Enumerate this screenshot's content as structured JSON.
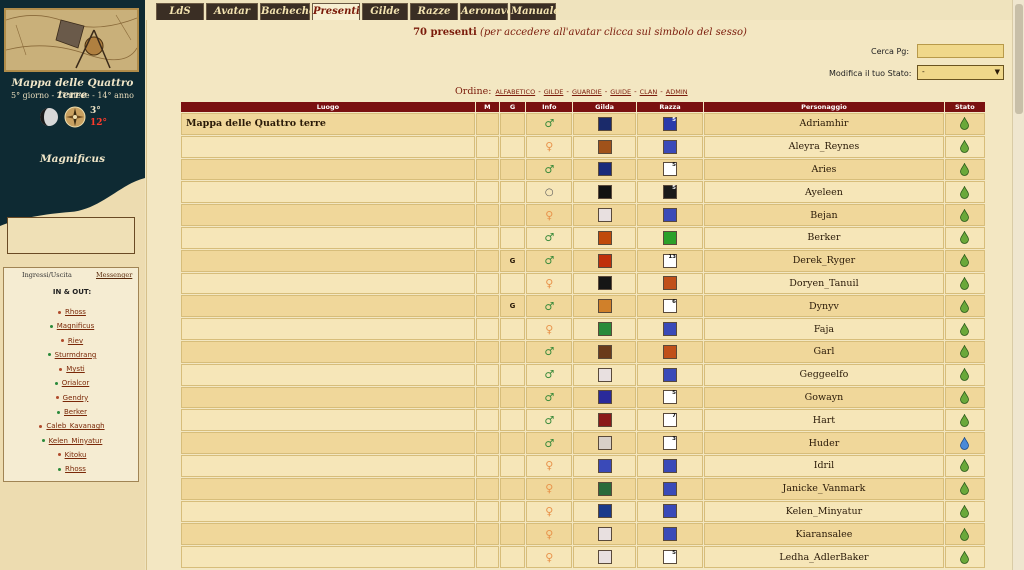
{
  "sidebar": {
    "world_title": "Mappa delle Quattro terre",
    "date": "5° giorno - 2° mese - 14° anno",
    "temp_low": "3°",
    "temp_high": "12°",
    "user_name": "Magnificus",
    "inout": {
      "tab_ingressi": "Ingressi/Uscita",
      "tab_messenger": "Messenger",
      "heading": "IN & OUT:",
      "items": [
        {
          "name": "Rhoss",
          "dot": "#b04a2a"
        },
        {
          "name": "Magnificus",
          "dot": "#2a8a3a"
        },
        {
          "name": "Riev",
          "dot": "#b04a2a"
        },
        {
          "name": "Sturmdrang",
          "dot": "#2a8a3a"
        },
        {
          "name": "Mysti",
          "dot": "#b04a2a"
        },
        {
          "name": "Orialcor",
          "dot": "#2a8a3a"
        },
        {
          "name": "Gendry",
          "dot": "#b04a2a"
        },
        {
          "name": "Berker",
          "dot": "#2a8a3a"
        },
        {
          "name": "Caleb_Kavanagh",
          "dot": "#b04a2a"
        },
        {
          "name": "Kelen_Minyatur",
          "dot": "#2a8a3a"
        },
        {
          "name": "Kitoku",
          "dot": "#b04a2a"
        },
        {
          "name": "Rhoss",
          "dot": "#2a8a3a"
        }
      ]
    }
  },
  "tabs": [
    "LdS",
    "Avatar",
    "Bacheche",
    "Presenti",
    "Gilde",
    "Razze",
    "Aeronave",
    "Manuale"
  ],
  "active_tab": "Presenti",
  "header": {
    "count": "70 presenti",
    "hint": "(per accedere all'avatar clicca sul simbolo del sesso)",
    "cerca_label": "Cerca Pg:",
    "cerca_value": "",
    "stato_label": "Modifica il tuo Stato:",
    "stato_value": "-",
    "ordine_label": "Ordine:",
    "ordine_links": [
      "ALFABETICO",
      "GILDE",
      "GUARDIE",
      "GUIDE",
      "CLAN",
      "ADMIN"
    ]
  },
  "table": {
    "columns": [
      "Luogo",
      "M",
      "G",
      "Info",
      "Gilda",
      "Razza",
      "Personaggio",
      "Stato"
    ],
    "location": "Mappa delle Quattro terre",
    "rows": [
      {
        "g": "",
        "sex": "m",
        "gilda": "#1a2a6a",
        "razza": "#2a3aaa",
        "razza_num": "5",
        "name": "Adriamhir",
        "stato": "green"
      },
      {
        "g": "",
        "sex": "f",
        "gilda": "#a0521a",
        "razza": "#3a4ab8",
        "razza_num": "",
        "name": "Aleyra_Reynes",
        "stato": "green"
      },
      {
        "g": "",
        "sex": "m",
        "gilda": "#1a2a7a",
        "razza": "#ffffff",
        "razza_num": "5",
        "name": "Aries",
        "stato": "green"
      },
      {
        "g": "",
        "sex": "n",
        "gilda": "#111111",
        "razza": "#1a1a1a",
        "razza_num": "5",
        "name": "Ayeleen",
        "stato": "green"
      },
      {
        "g": "",
        "sex": "f",
        "gilda": "#e8e0e0",
        "razza": "#3a4ab8",
        "razza_num": "",
        "name": "Bejan",
        "stato": "green"
      },
      {
        "g": "",
        "sex": "m",
        "gilda": "#c04a0a",
        "razza": "#2aa02a",
        "razza_num": "",
        "name": "Berker",
        "stato": "green"
      },
      {
        "g": "G",
        "sex": "m",
        "gilda": "#c0300a",
        "razza": "#ffffff",
        "razza_num": "13",
        "name": "Derek_Ryger",
        "stato": "green"
      },
      {
        "g": "",
        "sex": "f",
        "gilda": "#151515",
        "razza": "#c0501a",
        "razza_num": "",
        "name": "Doryen_Tanuil",
        "stato": "green"
      },
      {
        "g": "G",
        "sex": "m",
        "gilda": "#d0802a",
        "razza": "#ffffff",
        "razza_num": "6",
        "name": "Dynyv",
        "stato": "green"
      },
      {
        "g": "",
        "sex": "f",
        "gilda": "#2a8a3a",
        "razza": "#3a4ab8",
        "razza_num": "",
        "name": "Faja",
        "stato": "green"
      },
      {
        "g": "",
        "sex": "m",
        "gilda": "#6a3a1a",
        "razza": "#c0501a",
        "razza_num": "",
        "name": "Garl",
        "stato": "green"
      },
      {
        "g": "",
        "sex": "m",
        "gilda": "#e8e0e0",
        "razza": "#3a4ab8",
        "razza_num": "",
        "name": "Geggeelfo",
        "stato": "green"
      },
      {
        "g": "",
        "sex": "m",
        "gilda": "#2a2a9a",
        "razza": "#ffffff",
        "razza_num": "5",
        "name": "Gowayn",
        "stato": "green"
      },
      {
        "g": "",
        "sex": "m",
        "gilda": "#8a1a1a",
        "razza": "#ffffff",
        "razza_num": "7",
        "name": "Hart",
        "stato": "green"
      },
      {
        "g": "",
        "sex": "m",
        "gilda": "#d8d0c8",
        "razza": "#ffffff",
        "razza_num": "3",
        "name": "Huder",
        "stato": "blue"
      },
      {
        "g": "",
        "sex": "f",
        "gilda": "#3a4ab8",
        "razza": "#3a4ab8",
        "razza_num": "",
        "name": "Idril",
        "stato": "green"
      },
      {
        "g": "",
        "sex": "f",
        "gilda": "#2a6a3a",
        "razza": "#3a4ab8",
        "razza_num": "",
        "name": "Janicke_Vanmark",
        "stato": "green"
      },
      {
        "g": "",
        "sex": "f",
        "gilda": "#1a3a8a",
        "razza": "#3a4ab8",
        "razza_num": "",
        "name": "Kelen_Minyatur",
        "stato": "green"
      },
      {
        "g": "",
        "sex": "f",
        "gilda": "#e8e0e0",
        "razza": "#3a4ab8",
        "razza_num": "",
        "name": "Kiaransalee",
        "stato": "green"
      },
      {
        "g": "",
        "sex": "f",
        "gilda": "#e8e0e0",
        "razza": "#ffffff",
        "razza_num": "5",
        "name": "Ledha_AdlerBaker",
        "stato": "green"
      }
    ]
  },
  "colors": {
    "dark_panel": "#0e2a33",
    "table_header": "#7a1010",
    "accent": "#7a1a0a",
    "row_odd": "#f0d79a",
    "row_even": "#f6e6b8",
    "male": "#3a8a3a",
    "female": "#e8924a"
  }
}
